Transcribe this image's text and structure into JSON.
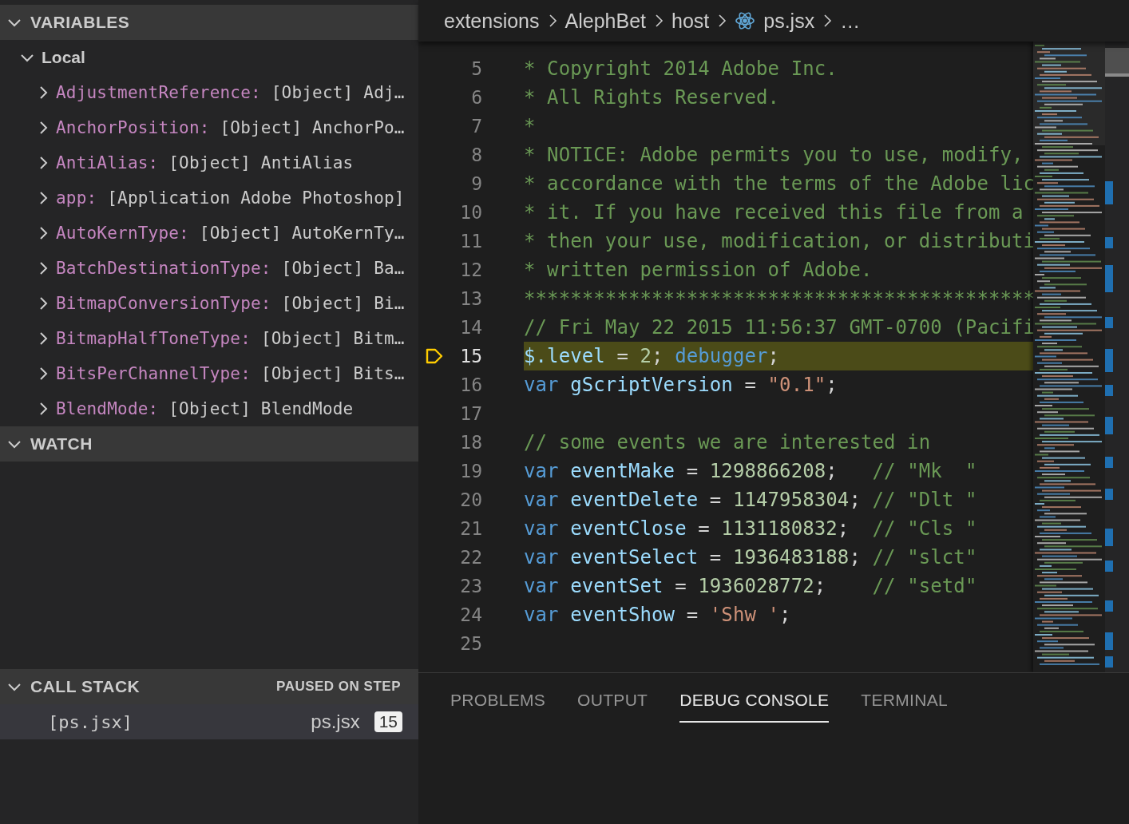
{
  "variables": {
    "title": "VARIABLES",
    "expanded": true,
    "scopes": [
      {
        "name": "Local",
        "expanded": true,
        "items": [
          {
            "name": "AdjustmentReference:",
            "value": "[Object] Adj…",
            "expanded": false
          },
          {
            "name": "AnchorPosition:",
            "value": "[Object] AnchorPo…",
            "expanded": false
          },
          {
            "name": "AntiAlias:",
            "value": "[Object] AntiAlias",
            "expanded": false
          },
          {
            "name": "app:",
            "value": "[Application Adobe Photoshop]",
            "expanded": false
          },
          {
            "name": "AutoKernType:",
            "value": "[Object] AutoKernTy…",
            "expanded": false
          },
          {
            "name": "BatchDestinationType:",
            "value": "[Object] Ba…",
            "expanded": false
          },
          {
            "name": "BitmapConversionType:",
            "value": "[Object] Bi…",
            "expanded": false
          },
          {
            "name": "BitmapHalfToneType:",
            "value": "[Object] Bitm…",
            "expanded": false
          },
          {
            "name": "BitsPerChannelType:",
            "value": "[Object] Bits…",
            "expanded": false
          },
          {
            "name": "BlendMode:",
            "value": "[Object] BlendMode",
            "expanded": false
          }
        ]
      }
    ]
  },
  "watch": {
    "title": "WATCH",
    "expanded": true
  },
  "call_stack": {
    "title": "CALL STACK",
    "expanded": true,
    "status": "PAUSED ON STEP",
    "frames": [
      {
        "name": "[ps.jsx]",
        "file": "ps.jsx",
        "line": "15"
      }
    ]
  },
  "breadcrumbs": [
    {
      "label": "extensions",
      "kind": "folder"
    },
    {
      "label": "AlephBet",
      "kind": "folder"
    },
    {
      "label": "host",
      "kind": "folder"
    },
    {
      "label": "ps.jsx",
      "kind": "file"
    },
    {
      "label": "…",
      "kind": "more"
    }
  ],
  "code": [
    {
      "number": "5",
      "current": false,
      "tokens": [
        {
          "kind": "comment",
          "text": "* Copyright 2014 Adobe Inc."
        }
      ]
    },
    {
      "number": "6",
      "current": false,
      "tokens": [
        {
          "kind": "comment",
          "text": "* All Rights Reserved."
        }
      ]
    },
    {
      "number": "7",
      "current": false,
      "tokens": [
        {
          "kind": "comment",
          "text": "*"
        }
      ]
    },
    {
      "number": "8",
      "current": false,
      "tokens": [
        {
          "kind": "comment",
          "text": "* NOTICE: Adobe permits you to use, modify,"
        }
      ]
    },
    {
      "number": "9",
      "current": false,
      "tokens": [
        {
          "kind": "comment",
          "text": "* accordance with the terms of the Adobe lic"
        }
      ]
    },
    {
      "number": "10",
      "current": false,
      "tokens": [
        {
          "kind": "comment",
          "text": "* it. If you have received this file from a"
        }
      ]
    },
    {
      "number": "11",
      "current": false,
      "tokens": [
        {
          "kind": "comment",
          "text": "* then your use, modification, or distributi"
        }
      ]
    },
    {
      "number": "12",
      "current": false,
      "tokens": [
        {
          "kind": "comment",
          "text": "* written permission of Adobe."
        }
      ]
    },
    {
      "number": "13",
      "current": false,
      "tokens": [
        {
          "kind": "comment",
          "text": "********************************************"
        }
      ]
    },
    {
      "number": "14",
      "current": false,
      "tokens": [
        {
          "kind": "comment",
          "text": "// Fri May 22 2015 11:56:37 GMT-0700 (Pacifi"
        }
      ]
    },
    {
      "number": "15",
      "current": true,
      "tokens": [
        {
          "kind": "ident",
          "text": "$.level"
        },
        {
          "kind": "plain",
          "text": " = "
        },
        {
          "kind": "number",
          "text": "2"
        },
        {
          "kind": "plain",
          "text": "; "
        },
        {
          "kind": "keyword",
          "text": "debugger"
        },
        {
          "kind": "plain",
          "text": ";"
        }
      ]
    },
    {
      "number": "16",
      "current": false,
      "tokens": [
        {
          "kind": "keyword",
          "text": "var "
        },
        {
          "kind": "ident",
          "text": "gScriptVersion"
        },
        {
          "kind": "plain",
          "text": " = "
        },
        {
          "kind": "string",
          "text": "\"0.1\""
        },
        {
          "kind": "plain",
          "text": ";"
        }
      ]
    },
    {
      "number": "17",
      "current": false
    },
    {
      "number": "18",
      "current": false,
      "tokens": [
        {
          "kind": "comment",
          "text": "// some events we are interested in"
        }
      ]
    },
    {
      "number": "19",
      "current": false,
      "tokens": [
        {
          "kind": "keyword",
          "text": "var "
        },
        {
          "kind": "ident",
          "text": "eventMake"
        },
        {
          "kind": "plain",
          "text": " = "
        },
        {
          "kind": "number",
          "text": "1298866208"
        },
        {
          "kind": "plain",
          "text": ";   "
        },
        {
          "kind": "comment",
          "text": "// \"Mk  \""
        }
      ]
    },
    {
      "number": "20",
      "current": false,
      "tokens": [
        {
          "kind": "keyword",
          "text": "var "
        },
        {
          "kind": "ident",
          "text": "eventDelete"
        },
        {
          "kind": "plain",
          "text": " = "
        },
        {
          "kind": "number",
          "text": "1147958304"
        },
        {
          "kind": "plain",
          "text": "; "
        },
        {
          "kind": "comment",
          "text": "// \"Dlt \""
        }
      ]
    },
    {
      "number": "21",
      "current": false,
      "tokens": [
        {
          "kind": "keyword",
          "text": "var "
        },
        {
          "kind": "ident",
          "text": "eventClose"
        },
        {
          "kind": "plain",
          "text": " = "
        },
        {
          "kind": "number",
          "text": "1131180832"
        },
        {
          "kind": "plain",
          "text": ";  "
        },
        {
          "kind": "comment",
          "text": "// \"Cls \""
        }
      ]
    },
    {
      "number": "22",
      "current": false,
      "tokens": [
        {
          "kind": "keyword",
          "text": "var "
        },
        {
          "kind": "ident",
          "text": "eventSelect"
        },
        {
          "kind": "plain",
          "text": " = "
        },
        {
          "kind": "number",
          "text": "1936483188"
        },
        {
          "kind": "plain",
          "text": "; "
        },
        {
          "kind": "comment",
          "text": "// \"slct\""
        }
      ]
    },
    {
      "number": "23",
      "current": false,
      "tokens": [
        {
          "kind": "keyword",
          "text": "var "
        },
        {
          "kind": "ident",
          "text": "eventSet"
        },
        {
          "kind": "plain",
          "text": " = "
        },
        {
          "kind": "number",
          "text": "1936028772"
        },
        {
          "kind": "plain",
          "text": ";    "
        },
        {
          "kind": "comment",
          "text": "// \"setd\""
        }
      ]
    },
    {
      "number": "24",
      "current": false,
      "tokens": [
        {
          "kind": "keyword",
          "text": "var "
        },
        {
          "kind": "ident",
          "text": "eventShow"
        },
        {
          "kind": "plain",
          "text": " = "
        },
        {
          "kind": "string",
          "text": "'Shw '"
        },
        {
          "kind": "plain",
          "text": ";"
        }
      ]
    },
    {
      "number": "25",
      "current": false
    }
  ],
  "panel_tabs": [
    {
      "label": "PROBLEMS",
      "selected": false
    },
    {
      "label": "OUTPUT",
      "selected": false
    },
    {
      "label": "DEBUG CONSOLE",
      "selected": true
    },
    {
      "label": "TERMINAL",
      "selected": false
    }
  ]
}
